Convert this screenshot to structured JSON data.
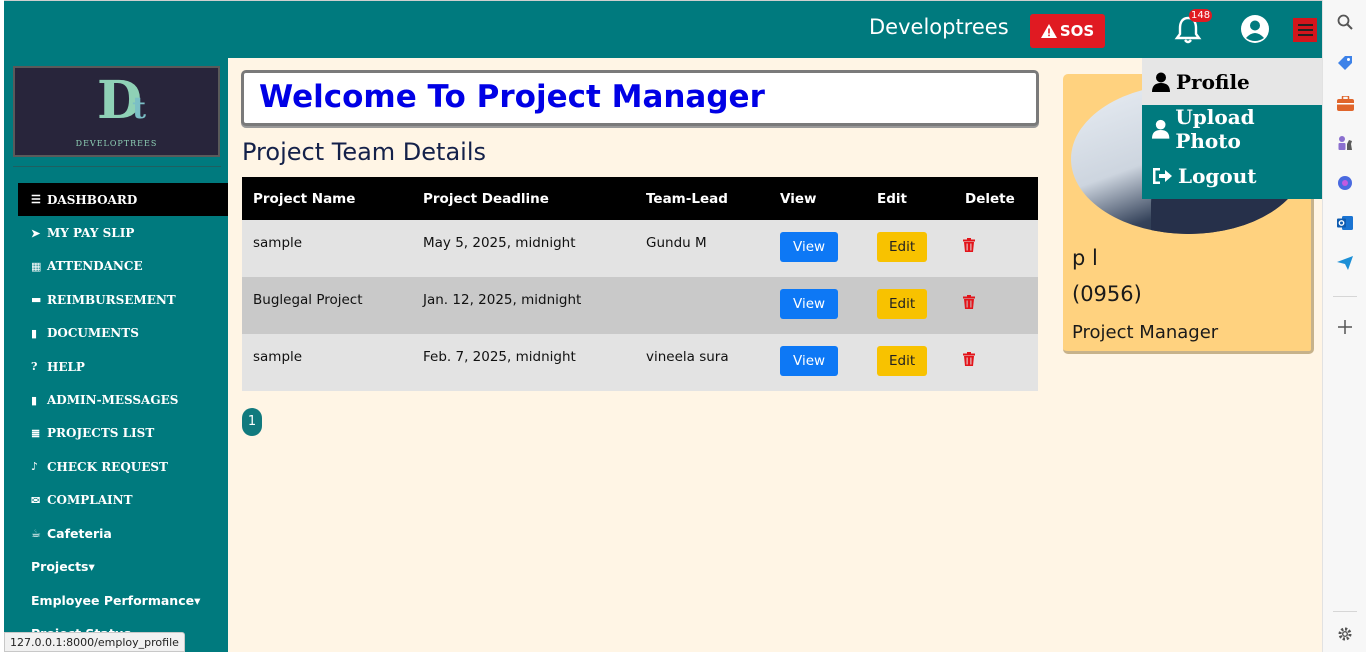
{
  "header": {
    "brand": "Developtrees",
    "sos_label": "SOS",
    "notification_count": "148"
  },
  "sidebar": {
    "logo_mark": "Dt",
    "logo_text": "DEVELOPTREES",
    "items": [
      {
        "label": "DASHBOARD",
        "icon": "bars-icon"
      },
      {
        "label": "MY PAY SLIP",
        "icon": "paper-plane-icon"
      },
      {
        "label": "ATTENDANCE",
        "icon": "calendar-icon"
      },
      {
        "label": "REIMBURSEMENT",
        "icon": "credit-card-icon"
      },
      {
        "label": "DOCUMENTS",
        "icon": "file-icon"
      },
      {
        "label": "HELP",
        "icon": "question-circle-icon"
      },
      {
        "label": "ADMIN-MESSAGES",
        "icon": "file-icon"
      },
      {
        "label": "PROJECTS LIST",
        "icon": "list-icon"
      },
      {
        "label": "CHECK REQUEST",
        "icon": "bell-icon"
      },
      {
        "label": "COMPLAINT",
        "icon": "envelope-icon"
      },
      {
        "label": "Cafeteria",
        "icon": "coffee-icon"
      },
      {
        "label": "Projects▾",
        "icon": ""
      },
      {
        "label": "Employee Performance▾",
        "icon": ""
      },
      {
        "label": "Project Status",
        "icon": ""
      }
    ]
  },
  "status_url": "127.0.0.1:8000/employ_profile",
  "main": {
    "welcome": "Welcome To Project Manager",
    "section_title": "Project Team Details",
    "table": {
      "headers": [
        "Project Name",
        "Project Deadline",
        "Team-Lead",
        "View",
        "Edit",
        "Delete"
      ],
      "rows": [
        {
          "name": "sample",
          "deadline": "May 5, 2025, midnight",
          "lead": "Gundu M"
        },
        {
          "name": "Buglegal Project",
          "deadline": "Jan. 12, 2025, midnight",
          "lead": ""
        },
        {
          "name": "sample",
          "deadline": "Feb. 7, 2025, midnight",
          "lead": "vineela sura"
        }
      ],
      "view_label": "View",
      "edit_label": "Edit"
    },
    "page_number": "1"
  },
  "profile": {
    "name": "p l",
    "id": "(0956)",
    "role": "Project Manager"
  },
  "dropdown": {
    "items": [
      "Profile",
      "Upload Photo",
      "Logout"
    ]
  },
  "colors": {
    "teal": "#007a7e",
    "main_bg": "#fff5e5",
    "sos_red": "#e01a22",
    "welcome_blue": "#0000e5",
    "view_blue": "#0d78f5",
    "edit_yellow": "#f8c200",
    "card_yellow": "#ffd27f"
  }
}
